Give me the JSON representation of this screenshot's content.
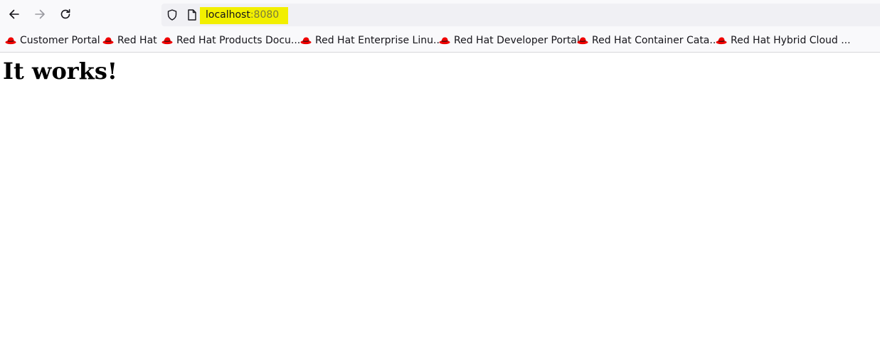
{
  "browser": {
    "url_host": "localhost",
    "url_port": ":8080",
    "highlight_color": "#f2ef00"
  },
  "bookmarks": [
    {
      "label": "Customer Portal",
      "icon": "redhat-hat-icon"
    },
    {
      "label": "Red Hat",
      "icon": "redhat-hat-icon"
    },
    {
      "label": "Red Hat Products Docu...",
      "icon": "redhat-hat-icon"
    },
    {
      "label": "Red Hat Enterprise Linu...",
      "icon": "redhat-hat-icon"
    },
    {
      "label": "Red Hat Developer Portal",
      "icon": "redhat-hat-icon"
    },
    {
      "label": "Red Hat Container Cata...",
      "icon": "redhat-hat-icon"
    },
    {
      "label": "Red Hat Hybrid Cloud ...",
      "icon": "redhat-hat-icon"
    }
  ],
  "page": {
    "heading": "It works!"
  }
}
